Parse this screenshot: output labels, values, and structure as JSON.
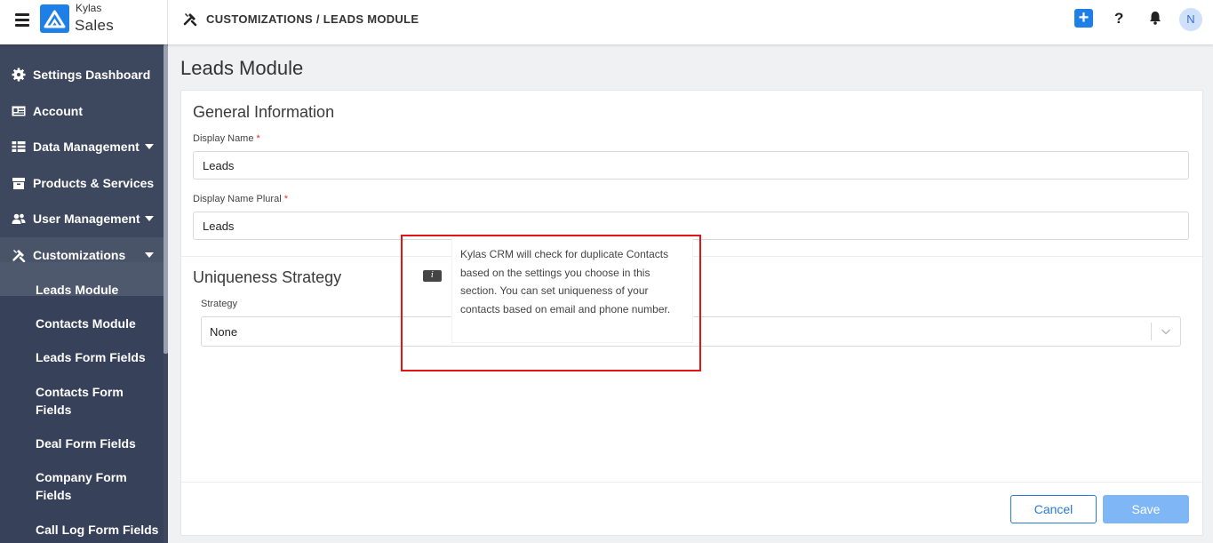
{
  "header": {
    "brand_top": "Kylas",
    "brand_bottom": "Sales",
    "breadcrumb": "CUSTOMIZATIONS / LEADS MODULE",
    "plus_label": "+",
    "help_label": "?",
    "avatar_initial": "N"
  },
  "sidebar": {
    "items": [
      {
        "label": "Settings Dashboard",
        "icon": "gear-icon"
      },
      {
        "label": "Account",
        "icon": "id-card-icon"
      },
      {
        "label": "Data Management",
        "icon": "table-icon"
      },
      {
        "label": "Products & Services",
        "icon": "box-icon"
      },
      {
        "label": "User Management",
        "icon": "users-icon"
      },
      {
        "label": "Customizations",
        "icon": "tools-icon"
      }
    ],
    "sub_items": [
      {
        "label": "Leads Module"
      },
      {
        "label": "Contacts Module"
      },
      {
        "label": "Leads Form Fields"
      },
      {
        "label": "Contacts Form Fields"
      },
      {
        "label": "Deal Form Fields"
      },
      {
        "label": "Company Form Fields"
      },
      {
        "label": "Call Log Form Fields"
      }
    ]
  },
  "main": {
    "page_title": "Leads Module",
    "general_title": "General Information",
    "display_name_label": "Display Name",
    "display_name_value": "Leads",
    "display_name_plural_label": "Display Name Plural",
    "display_name_plural_value": "Leads",
    "required_mark": "*",
    "uniqueness_title": "Uniqueness Strategy",
    "strategy_label": "Strategy",
    "strategy_value": "None",
    "cancel_label": "Cancel",
    "save_label": "Save"
  },
  "tooltip": {
    "icon_label": "i",
    "text": "Kylas CRM will check for duplicate Contacts based on the settings you choose in this section. You can set uniqueness of your contacts based on email and phone number."
  },
  "colors": {
    "accent": "#1e7fe6",
    "sidebar_bg": "#3d475d",
    "highlight_border": "#e01515",
    "save_disabled": "#7fb6f5"
  }
}
